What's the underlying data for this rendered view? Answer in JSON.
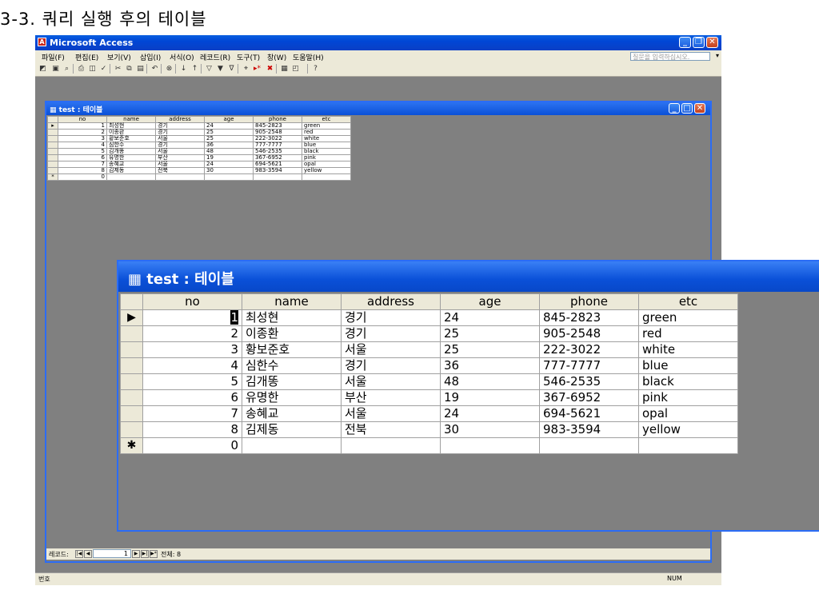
{
  "heading": "3-3.  쿼리 실행 후의 테이블",
  "app": {
    "title": "Microsoft Access",
    "menus": [
      "파일(F)",
      "편집(E)",
      "보기(V)",
      "삽입(I)",
      "서식(O)",
      "레코드(R)",
      "도구(T)",
      "창(W)",
      "도움말(H)"
    ],
    "ask_placeholder": "질문을 입력하십시오.",
    "status_left": "번호",
    "status_right": "NUM"
  },
  "table_window": {
    "title": "test : 테이블",
    "columns": [
      "no",
      "name",
      "address",
      "age",
      "phone",
      "etc"
    ],
    "rows": [
      [
        "1",
        "최성현",
        "경기",
        "24",
        "845-2823",
        "green"
      ],
      [
        "2",
        "이종환",
        "경기",
        "25",
        "905-2548",
        "red"
      ],
      [
        "3",
        "황보준호",
        "서울",
        "25",
        "222-3022",
        "white"
      ],
      [
        "4",
        "심한수",
        "경기",
        "36",
        "777-7777",
        "blue"
      ],
      [
        "5",
        "김개똥",
        "서울",
        "48",
        "546-2535",
        "black"
      ],
      [
        "6",
        "유명한",
        "부산",
        "19",
        "367-6952",
        "pink"
      ],
      [
        "7",
        "송혜교",
        "서울",
        "24",
        "694-5621",
        "opal"
      ],
      [
        "8",
        "김제동",
        "전북",
        "30",
        "983-3594",
        "yellow"
      ]
    ],
    "new_row_no": "0",
    "nav": {
      "label": "레코드:",
      "current": "1",
      "total": "전체: 8"
    }
  }
}
